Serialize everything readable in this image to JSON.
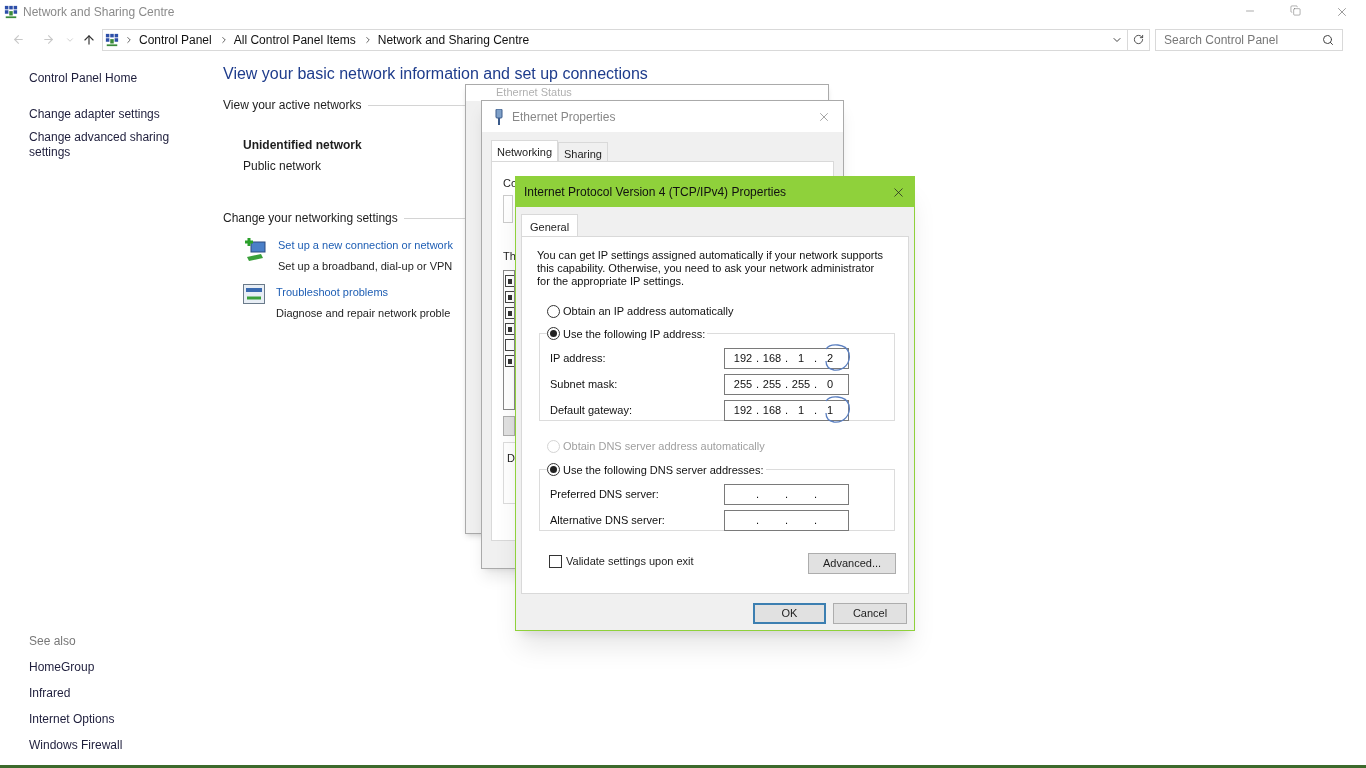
{
  "window": {
    "title": "Network and Sharing Centre"
  },
  "address_bar": {
    "breadcrumbs": [
      "Control Panel",
      "All Control Panel Items",
      "Network and Sharing Centre"
    ]
  },
  "search": {
    "placeholder": "Search Control Panel"
  },
  "sidebar": {
    "items": [
      "Control Panel Home",
      "Change adapter settings",
      "Change advanced sharing settings"
    ],
    "see_also": {
      "heading": "See also",
      "items": [
        "HomeGroup",
        "Infrared",
        "Internet Options",
        "Windows Firewall"
      ]
    }
  },
  "main": {
    "heading": "View your basic network information and set up connections",
    "active_networks": {
      "label": "View your active networks",
      "network_name": "Unidentified network",
      "network_type": "Public network"
    },
    "settings": {
      "label": "Change your networking settings",
      "tasks": [
        {
          "kind": "setup",
          "title": "Set up a new connection or network",
          "description": "Set up a broadband, dial-up or VPN"
        },
        {
          "kind": "troubleshoot",
          "title": "Troubleshoot problems",
          "description": "Diagnose and repair network proble"
        }
      ]
    }
  },
  "ethernet_status": {
    "title": "Ethernet Status"
  },
  "ethernet_properties": {
    "title": "Ethernet Properties",
    "tabs": [
      {
        "label": "Networking",
        "selected": true
      },
      {
        "label": "Sharing",
        "selected": false
      }
    ],
    "fragments": [
      "Co",
      "Th",
      "D"
    ],
    "components": [
      {
        "checked": true
      },
      {
        "checked": true
      },
      {
        "checked": true
      },
      {
        "checked": true
      },
      {
        "checked": false
      },
      {
        "checked": true
      }
    ]
  },
  "ipv4_dialog": {
    "title": "Internet Protocol Version 4 (TCP/IPv4) Properties",
    "tabs": [
      {
        "label": "General",
        "selected": true
      }
    ],
    "intro": "You can get IP settings assigned automatically if your network supports this capability. Otherwise, you need to ask your network administrator for the appropriate IP settings.",
    "ip_options": [
      {
        "label": "Obtain an IP address automatically",
        "selected": false,
        "disabled": false
      },
      {
        "label": "Use the following IP address:",
        "selected": true,
        "disabled": false
      }
    ],
    "ip_fields": [
      {
        "label": "IP address:",
        "octets": [
          "192",
          "168",
          "1",
          "2"
        ],
        "separators": [
          ".",
          ".",
          "."
        ],
        "circled": true
      },
      {
        "label": "Subnet mask:",
        "octets": [
          "255",
          "255",
          "255",
          "0"
        ],
        "separators": [
          ".",
          ".",
          "."
        ],
        "circled": false
      },
      {
        "label": "Default gateway:",
        "octets": [
          "192",
          "168",
          "1",
          "1"
        ],
        "separators": [
          ".",
          ".",
          "."
        ],
        "circled": true
      }
    ],
    "dns_options": [
      {
        "label": "Obtain DNS server address automatically",
        "selected": false,
        "disabled": true
      },
      {
        "label": "Use the following DNS server addresses:",
        "selected": true,
        "disabled": false
      }
    ],
    "dns_fields": [
      {
        "label": "Preferred DNS server:",
        "separators": [
          ".",
          ".",
          "."
        ],
        "circled": false
      },
      {
        "label": "Alternative DNS server:",
        "separators": [
          ".",
          ".",
          "."
        ],
        "circled": false
      }
    ],
    "validate": {
      "label": "Validate settings upon exit",
      "checked": false
    },
    "advanced_button": "Advanced...",
    "ok_button": "OK",
    "cancel_button": "Cancel"
  }
}
